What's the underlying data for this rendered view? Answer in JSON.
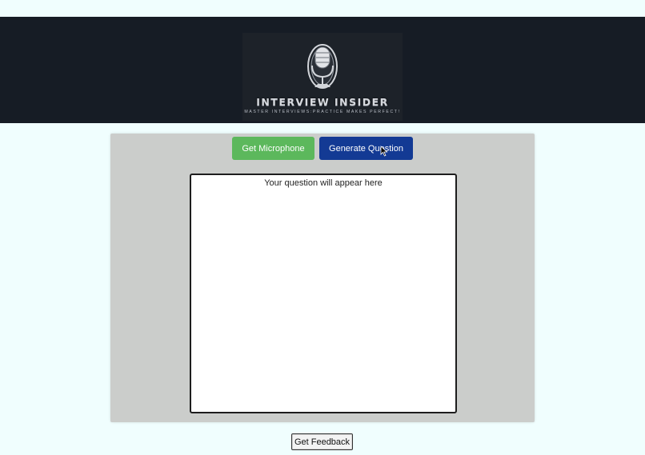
{
  "header": {
    "logo_title": "INTERVIEW INSIDER",
    "logo_tagline": "MASTER INTERVIEWS:PRACTICE MAKES PERFECT!",
    "logo_icon": "microphone-icon"
  },
  "controls": {
    "microphone_label": "Get Microphone",
    "generate_label": "Generate Question"
  },
  "question": {
    "placeholder": "Your question will appear here"
  },
  "footer": {
    "feedback_label": "Get Feedback"
  },
  "colors": {
    "header_bg": "#161c25",
    "page_bg": "#f0fefe",
    "panel_bg": "#cbcdcb",
    "microphone_button": "#5cb85c",
    "generate_button": "#133a94"
  }
}
